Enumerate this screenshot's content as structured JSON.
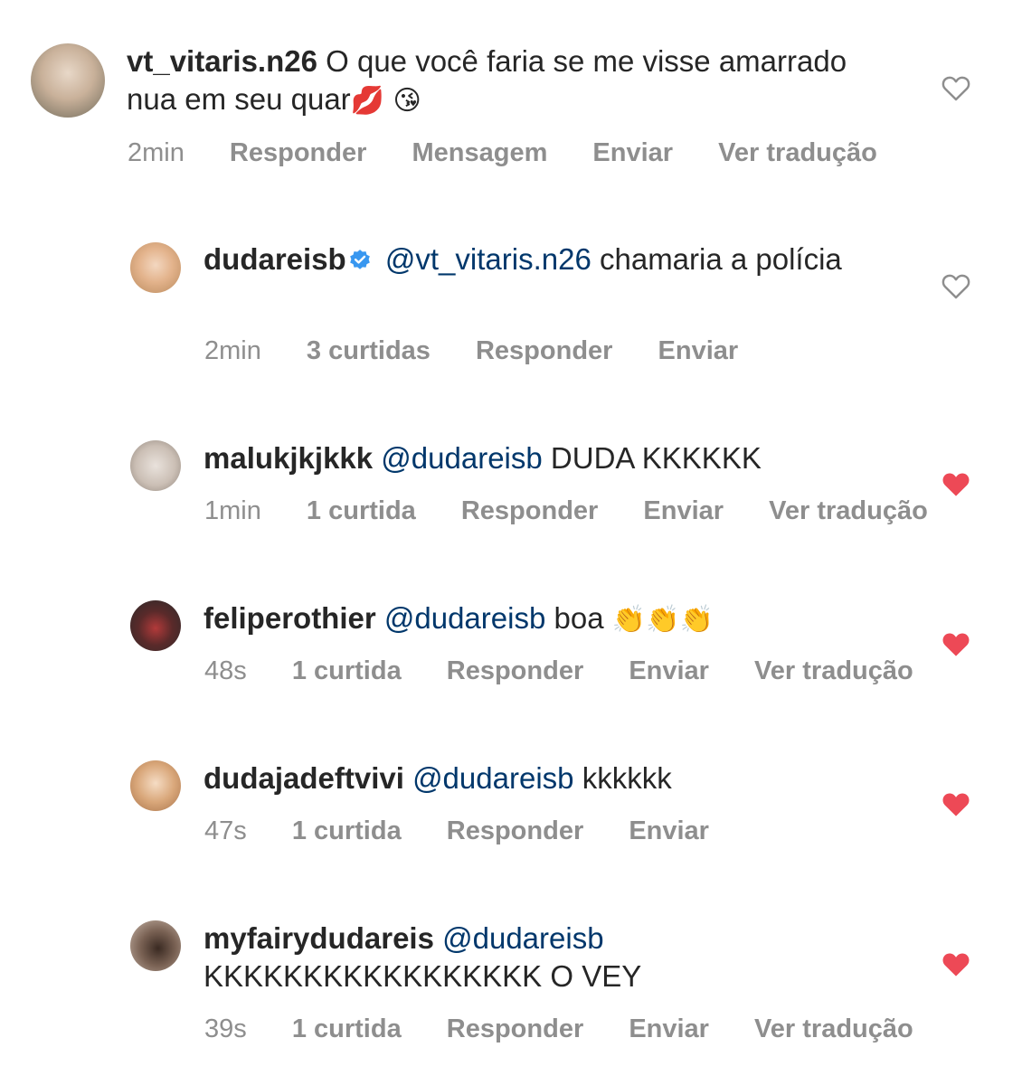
{
  "comments": [
    {
      "username": "vt_vitaris.n26",
      "text": "O que você faria se me visse amarrado nua em seu quar",
      "emojis": "💋 😘",
      "time": "2min",
      "actions": [
        "Responder",
        "Mensagem",
        "Enviar",
        "Ver tradução"
      ],
      "liked": false
    },
    {
      "username": "dudareisb",
      "verified": true,
      "mention": "@vt_vitaris.n26",
      "text": "chamaria a polícia",
      "time": "2min",
      "likes": "3 curtidas",
      "actions": [
        "Responder",
        "Enviar"
      ],
      "liked": false
    },
    {
      "username": "malukjkjkkk",
      "mention": "@dudareisb",
      "text": "DUDA KKKKKK",
      "time": "1min",
      "likes": "1 curtida",
      "actions": [
        "Responder",
        "Enviar",
        "Ver tradução"
      ],
      "liked": true
    },
    {
      "username": "feliperothier",
      "mention": "@dudareisb",
      "text": "boa",
      "emojis": "👏👏👏",
      "time": "48s",
      "likes": "1 curtida",
      "actions": [
        "Responder",
        "Enviar",
        "Ver tradução"
      ],
      "liked": true
    },
    {
      "username": "dudajadeftvivi",
      "mention": "@dudareisb",
      "text": "kkkkkk",
      "time": "47s",
      "likes": "1 curtida",
      "actions": [
        "Responder",
        "Enviar"
      ],
      "liked": true
    },
    {
      "username": "myfairydudareis",
      "mention": "@dudareisb",
      "text": "KKKKKKKKKKKKKKKKK O VEY",
      "time": "39s",
      "likes": "1 curtida",
      "actions": [
        "Responder",
        "Enviar",
        "Ver tradução"
      ],
      "liked": true
    }
  ],
  "colors": {
    "text": "#262626",
    "meta": "#8e8e8e",
    "mention": "#00376b",
    "heart_liked": "#ed4956",
    "verified": "#3897f0"
  }
}
